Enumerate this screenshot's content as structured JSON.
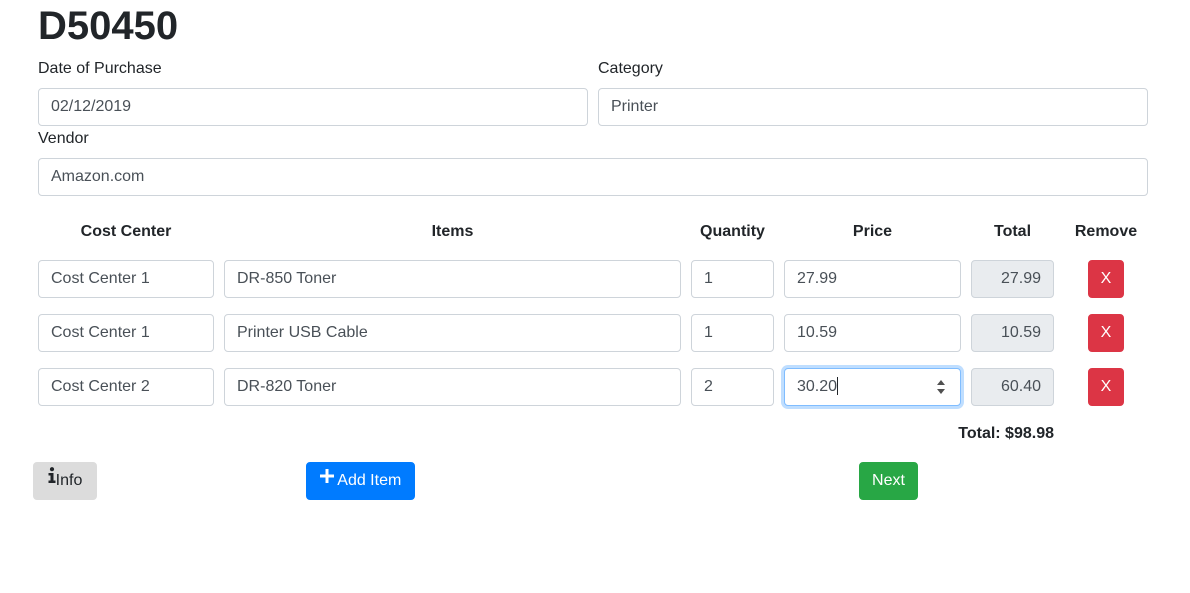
{
  "header": {
    "title": "D50450"
  },
  "form": {
    "date_label": "Date of Purchase",
    "date_value": "02/12/2019",
    "category_label": "Category",
    "category_value": "Printer",
    "vendor_label": "Vendor",
    "vendor_value": "Amazon.com"
  },
  "table": {
    "columns": [
      "Cost Center",
      "Items",
      "Quantity",
      "Price",
      "Total",
      "Remove"
    ],
    "rows": [
      {
        "cost_center": "Cost Center 1",
        "item": "DR-850 Toner",
        "quantity": "1",
        "price": "27.99",
        "total": "27.99",
        "remove_label": "X"
      },
      {
        "cost_center": "Cost Center 1",
        "item": "Printer USB Cable",
        "quantity": "1",
        "price": "10.59",
        "total": "10.59",
        "remove_label": "X"
      },
      {
        "cost_center": "Cost Center 2",
        "item": "DR-820 Toner",
        "quantity": "2",
        "price": "30.20",
        "total": "60.40",
        "remove_label": "X"
      }
    ],
    "grand_total": "Total: $98.98"
  },
  "actions": {
    "info_label": "Info",
    "add_item_label": "Add Item",
    "next_label": "Next"
  },
  "colors": {
    "danger": "#dc3545",
    "primary": "#007bff",
    "success": "#28a745",
    "secondary": "#dcdcdc",
    "readonly_bg": "#e9ecef",
    "focus_border": "#80bdff"
  },
  "icons": {
    "info": "info-icon",
    "add": "plus-icon",
    "spinner": "number-spinner-icon"
  }
}
